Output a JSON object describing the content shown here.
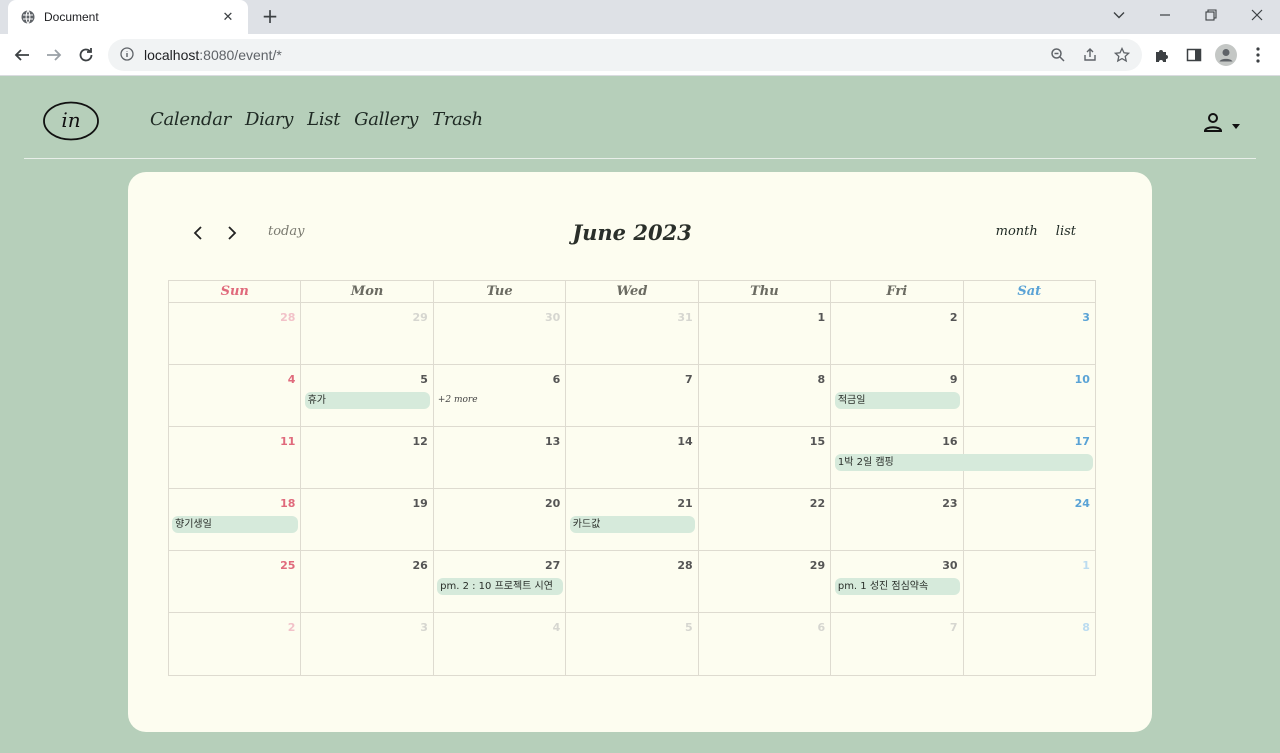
{
  "browser": {
    "tab_title": "Document",
    "tab_close": "✕",
    "new_tab": "+",
    "url_host": "localhost",
    "url_path": ":8080/event/*",
    "win_minimize": "—",
    "win_restore": "❐",
    "win_close": "✕",
    "tab_search": "⌄"
  },
  "header": {
    "logo_text": "in",
    "nav": [
      "Calendar",
      "Diary",
      "List",
      "Gallery",
      "Trash"
    ]
  },
  "calendar": {
    "title": "June 2023",
    "today_label": "today",
    "views": [
      "month",
      "list"
    ],
    "weekdays": [
      "Sun",
      "Mon",
      "Tue",
      "Wed",
      "Thu",
      "Fri",
      "Sat"
    ],
    "weeks": [
      {
        "days": [
          {
            "n": "28",
            "other": true
          },
          {
            "n": "29",
            "other": true
          },
          {
            "n": "30",
            "other": true
          },
          {
            "n": "31",
            "other": true
          },
          {
            "n": "1"
          },
          {
            "n": "2"
          },
          {
            "n": "3"
          }
        ]
      },
      {
        "days": [
          {
            "n": "4"
          },
          {
            "n": "5",
            "event": "휴가"
          },
          {
            "n": "6",
            "more": "+2 more"
          },
          {
            "n": "7"
          },
          {
            "n": "8"
          },
          {
            "n": "9",
            "event": "적금일"
          },
          {
            "n": "10"
          }
        ]
      },
      {
        "days": [
          {
            "n": "11"
          },
          {
            "n": "12"
          },
          {
            "n": "13"
          },
          {
            "n": "14"
          },
          {
            "n": "15"
          },
          {
            "n": "16",
            "event": "1박 2일 캠핑",
            "span": 2
          },
          {
            "n": "17"
          }
        ]
      },
      {
        "days": [
          {
            "n": "18",
            "event": "향기생일"
          },
          {
            "n": "19"
          },
          {
            "n": "20"
          },
          {
            "n": "21",
            "event": "카드값"
          },
          {
            "n": "22"
          },
          {
            "n": "23"
          },
          {
            "n": "24"
          }
        ]
      },
      {
        "days": [
          {
            "n": "25"
          },
          {
            "n": "26"
          },
          {
            "n": "27",
            "event": "pm. 2 : 10 프로젝트 시연"
          },
          {
            "n": "28"
          },
          {
            "n": "29"
          },
          {
            "n": "30",
            "event": "pm. 1 성진 점심약속"
          },
          {
            "n": "1",
            "other": true
          }
        ]
      },
      {
        "days": [
          {
            "n": "2",
            "other": true
          },
          {
            "n": "3",
            "other": true
          },
          {
            "n": "4",
            "other": true
          },
          {
            "n": "5",
            "other": true
          },
          {
            "n": "6",
            "other": true
          },
          {
            "n": "7",
            "other": true
          },
          {
            "n": "8",
            "other": true
          }
        ]
      }
    ]
  },
  "colors": {
    "page_bg": "#b6cfba",
    "card_bg": "#fdfdf0",
    "event_bg": "#d6eadb",
    "sunday": "#e06a7c",
    "saturday": "#5aa3d6"
  }
}
